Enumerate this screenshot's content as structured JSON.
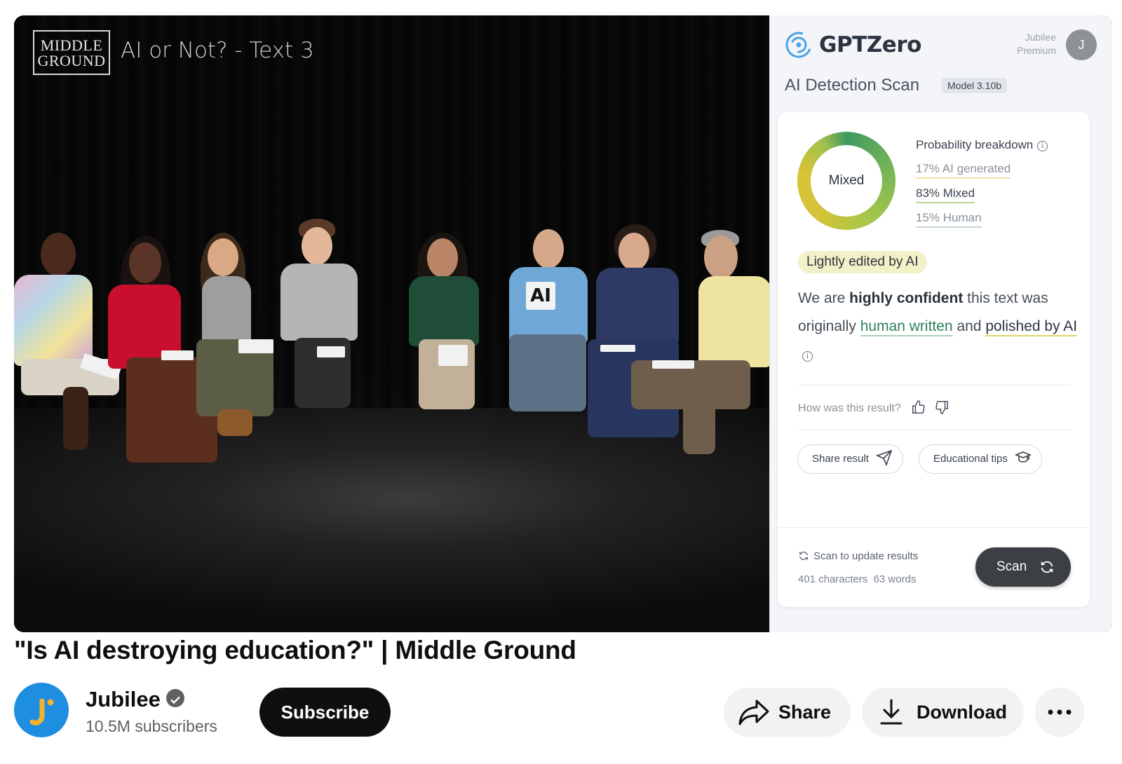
{
  "video": {
    "logo_line1": "MIDDLE",
    "logo_line2": "GROUND",
    "overlay_title": "AI or Not? - Text 3",
    "sign_text": "AI"
  },
  "gptzero": {
    "brand": "GPTZero",
    "user_name": "Jubilee",
    "user_plan": "Premium",
    "avatar_initial": "J",
    "scan_title": "AI Detection Scan",
    "model_badge": "Model 3.10b",
    "donut_label": "Mixed",
    "probability_title": "Probability breakdown",
    "prob_ai": "17% AI generated",
    "prob_mixed": "83% Mixed",
    "prob_human": "15% Human",
    "verdict_badge": "Lightly edited by AI",
    "confidence": {
      "p1": "We are ",
      "strong": "highly confident",
      "p2": " this text was originally ",
      "human": "human written",
      "p3": " and ",
      "polished": "polished by AI"
    },
    "feedback_question": "How was this result?",
    "share_label": "Share result",
    "tips_label": "Educational tips",
    "scan_update": "Scan to update results",
    "char_count": "401 characters",
    "word_count": "63 words",
    "scan_button": "Scan",
    "colors": {
      "human_green": "#2e7f5a",
      "ai_yellow": "#e4d46a",
      "scan_button": "#3c3f44"
    }
  },
  "youtube": {
    "title": "\"Is AI destroying education?\" | Middle Ground",
    "channel": "Jubilee",
    "subscribers": "10.5M subscribers",
    "subscribe_label": "Subscribe",
    "share_label": "Share",
    "download_label": "Download",
    "more_icon": "more-horizontal-icon"
  }
}
